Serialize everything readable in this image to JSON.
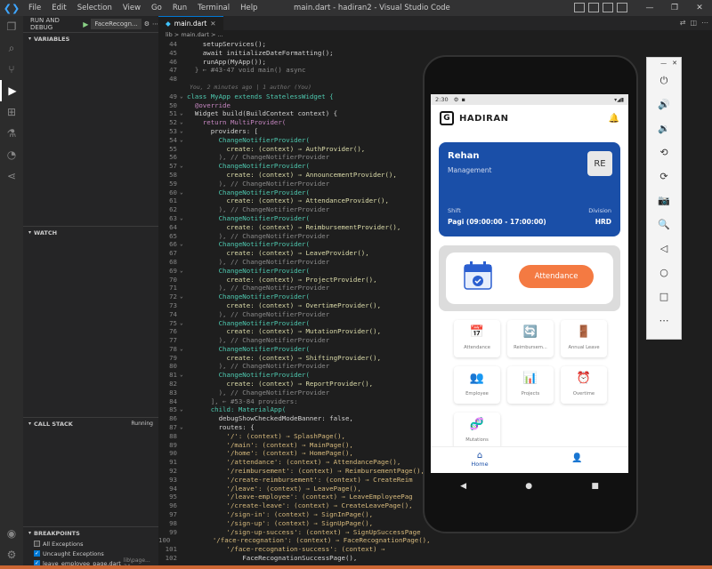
{
  "window": {
    "title": "main.dart - hadiran2 - Visual Studio Code",
    "menu": [
      "File",
      "Edit",
      "Selection",
      "View",
      "Go",
      "Run",
      "Terminal",
      "Help"
    ],
    "controls": [
      "—",
      "❐",
      "✕"
    ]
  },
  "activity": {
    "icons": [
      "files-icon",
      "search-icon",
      "source-control-icon",
      "run-debug-icon",
      "extensions-icon",
      "testing-icon",
      "git-history-icon",
      "remote-icon"
    ],
    "bottom": [
      "account-icon",
      "settings-icon"
    ]
  },
  "debug": {
    "title": "RUN AND DEBUG",
    "config": "FaceRecogn...",
    "sections": {
      "variables": "VARIABLES",
      "watch": "WATCH",
      "callstack": "CALL STACK",
      "running": "Running",
      "breakpoints": "BREAKPOINTS"
    },
    "breakpoints": [
      {
        "label": "All Exceptions",
        "checked": false,
        "path": ""
      },
      {
        "label": "Uncaught Exceptions",
        "checked": true,
        "path": ""
      },
      {
        "label": "leave_employee_page.dart",
        "checked": true,
        "path": "lib\\page... 24"
      }
    ]
  },
  "editor": {
    "tab": "main.dart",
    "breadcrumb": "lib > main.dart > ...",
    "blame": "You, 2 minutes ago | 1 author (You)",
    "lines": [
      {
        "n": "44",
        "t": "    setupServices();"
      },
      {
        "n": "45",
        "t": "    await initializeDateFormatting();"
      },
      {
        "n": "46",
        "t": "    runApp(MyApp());"
      },
      {
        "n": "47",
        "t": "  } ← #43-47 void main() async"
      },
      {
        "n": "48",
        "t": ""
      },
      {
        "n": "49",
        "t": "class MyApp extends StatelessWidget {"
      },
      {
        "n": "50",
        "t": "  @override"
      },
      {
        "n": "51",
        "t": "  Widget build(BuildContext context) {"
      },
      {
        "n": "52",
        "t": "    return MultiProvider("
      },
      {
        "n": "53",
        "t": "      providers: ["
      },
      {
        "n": "54",
        "t": "        ChangeNotifierProvider("
      },
      {
        "n": "55",
        "t": "          create: (context) ⇒ AuthProvider(),"
      },
      {
        "n": "56",
        "t": "        ), // ChangeNotifierProvider"
      },
      {
        "n": "57",
        "t": "        ChangeNotifierProvider("
      },
      {
        "n": "58",
        "t": "          create: (context) ⇒ AnnouncementProvider(),"
      },
      {
        "n": "59",
        "t": "        ), // ChangeNotifierProvider"
      },
      {
        "n": "60",
        "t": "        ChangeNotifierProvider("
      },
      {
        "n": "61",
        "t": "          create: (context) ⇒ AttendanceProvider(),"
      },
      {
        "n": "62",
        "t": "        ), // ChangeNotifierProvider"
      },
      {
        "n": "63",
        "t": "        ChangeNotifierProvider("
      },
      {
        "n": "64",
        "t": "          create: (context) ⇒ ReimbursementProvider(),"
      },
      {
        "n": "65",
        "t": "        ), // ChangeNotifierProvider"
      },
      {
        "n": "66",
        "t": "        ChangeNotifierProvider("
      },
      {
        "n": "67",
        "t": "          create: (context) ⇒ LeaveProvider(),"
      },
      {
        "n": "68",
        "t": "        ), // ChangeNotifierProvider"
      },
      {
        "n": "69",
        "t": "        ChangeNotifierProvider("
      },
      {
        "n": "70",
        "t": "          create: (context) ⇒ ProjectProvider(),"
      },
      {
        "n": "71",
        "t": "        ), // ChangeNotifierProvider"
      },
      {
        "n": "72",
        "t": "        ChangeNotifierProvider("
      },
      {
        "n": "73",
        "t": "          create: (context) ⇒ OvertimeProvider(),"
      },
      {
        "n": "74",
        "t": "        ), // ChangeNotifierProvider"
      },
      {
        "n": "75",
        "t": "        ChangeNotifierProvider("
      },
      {
        "n": "76",
        "t": "          create: (context) ⇒ MutationProvider(),"
      },
      {
        "n": "77",
        "t": "        ), // ChangeNotifierProvider"
      },
      {
        "n": "78",
        "t": "        ChangeNotifierProvider("
      },
      {
        "n": "79",
        "t": "          create: (context) ⇒ ShiftingProvider(),"
      },
      {
        "n": "80",
        "t": "        ), // ChangeNotifierProvider"
      },
      {
        "n": "81",
        "t": "        ChangeNotifierProvider("
      },
      {
        "n": "82",
        "t": "          create: (context) ⇒ ReportProvider(),"
      },
      {
        "n": "83",
        "t": "        ), // ChangeNotifierProvider"
      },
      {
        "n": "84",
        "t": "      ], ← #53-84 providers:"
      },
      {
        "n": "85",
        "t": "      child: MaterialApp("
      },
      {
        "n": "86",
        "t": "        debugShowCheckedModeBanner: false,"
      },
      {
        "n": "87",
        "t": "        routes: {"
      },
      {
        "n": "88",
        "t": "          '/': (context) ⇒ SplashPage(),"
      },
      {
        "n": "89",
        "t": "          '/main': (context) ⇒ MainPage(),"
      },
      {
        "n": "90",
        "t": "          '/home': (context) ⇒ HomePage(),"
      },
      {
        "n": "91",
        "t": "          '/attendance': (context) ⇒ AttendancePage(),"
      },
      {
        "n": "92",
        "t": "          '/reimbursement': (context) ⇒ ReimbursementPage(),"
      },
      {
        "n": "93",
        "t": "          '/create-reimbursement': (context) ⇒ CreateReim"
      },
      {
        "n": "94",
        "t": "          '/leave': (context) ⇒ LeavePage(),"
      },
      {
        "n": "95",
        "t": "          '/leave-employee': (context) ⇒ LeaveEmployeePag"
      },
      {
        "n": "96",
        "t": "          '/create-leave': (context) ⇒ CreateLeavePage(),"
      },
      {
        "n": "97",
        "t": "          '/sign-in': (context) ⇒ SignInPage(),"
      },
      {
        "n": "98",
        "t": "          '/sign-up': (context) ⇒ SignUpPage(),"
      },
      {
        "n": "99",
        "t": "          '/sign-up-success': (context) ⇒ SignUpSuccessPage"
      },
      {
        "n": "100",
        "t": "          '/face-recognation': (context) ⇒ FaceRecognationPage(),"
      },
      {
        "n": "101",
        "t": "          '/face-recognation-success': (context) ⇒"
      },
      {
        "n": "102",
        "t": "              FaceRecognationSuccessPage(),"
      }
    ]
  },
  "phone": {
    "status_time": "2:30",
    "status_icons": "▾◢▮",
    "brand": "HADIRAN",
    "profile": {
      "name": "Rehan",
      "role": "Management",
      "initials": "RE",
      "shift_label": "Shift",
      "shift": "Pagi (09:00:00 -  17:00:00)",
      "division_label": "Division",
      "division": "HRD"
    },
    "attendance_button": "Attendance",
    "menu": [
      {
        "label": "Attendance",
        "icon": "📅"
      },
      {
        "label": "Reimbursem...",
        "icon": "🔄"
      },
      {
        "label": "Annual Leave",
        "icon": "🚪"
      },
      {
        "label": "Employee",
        "icon": "👥"
      },
      {
        "label": "Projects",
        "icon": "📊"
      },
      {
        "label": "Overtime",
        "icon": "⏰"
      },
      {
        "label": "Mutations",
        "icon": "🧬"
      }
    ],
    "nav_home": "Home"
  },
  "emulator": {
    "top": [
      "—",
      "✕"
    ],
    "tools": [
      "⏻",
      "🔊",
      "🔉",
      "⟲",
      "⟳",
      "📷",
      "🔍",
      "◁",
      "○",
      "□",
      "⋯"
    ]
  }
}
